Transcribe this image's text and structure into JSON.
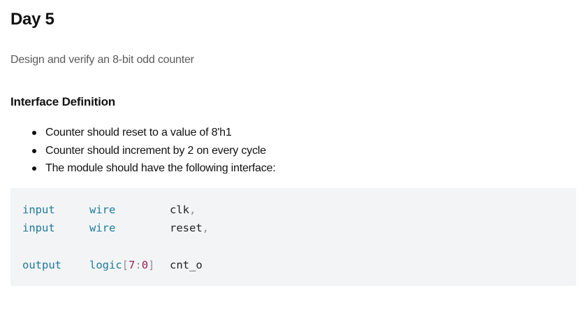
{
  "title": "Day 5",
  "subtitle": "Design and verify an 8-bit odd counter",
  "section_heading": "Interface Definition",
  "bullets": [
    "Counter should reset to a value of 8'h1",
    "Counter should increment by 2 on every cycle",
    "The module should have the following interface:"
  ],
  "code": {
    "lines": [
      {
        "direction": "input",
        "type": "wire",
        "name": "clk",
        "trail": ","
      },
      {
        "direction": "input",
        "type": "wire",
        "name": "reset",
        "trail": ","
      },
      {
        "direction": "output",
        "type_base": "logic",
        "range_open": "[",
        "range_msb": "7",
        "range_sep": ":",
        "range_lsb": "0",
        "range_close": "]",
        "name": "cnt_o"
      }
    ]
  },
  "colors": {
    "keyword": "#1f7a9a",
    "identifier": "#222222",
    "punctuation": "#8f8f8f",
    "number": "#9c1c52",
    "code_background": "#f2f4f6",
    "subtitle": "#5a5a5a"
  }
}
